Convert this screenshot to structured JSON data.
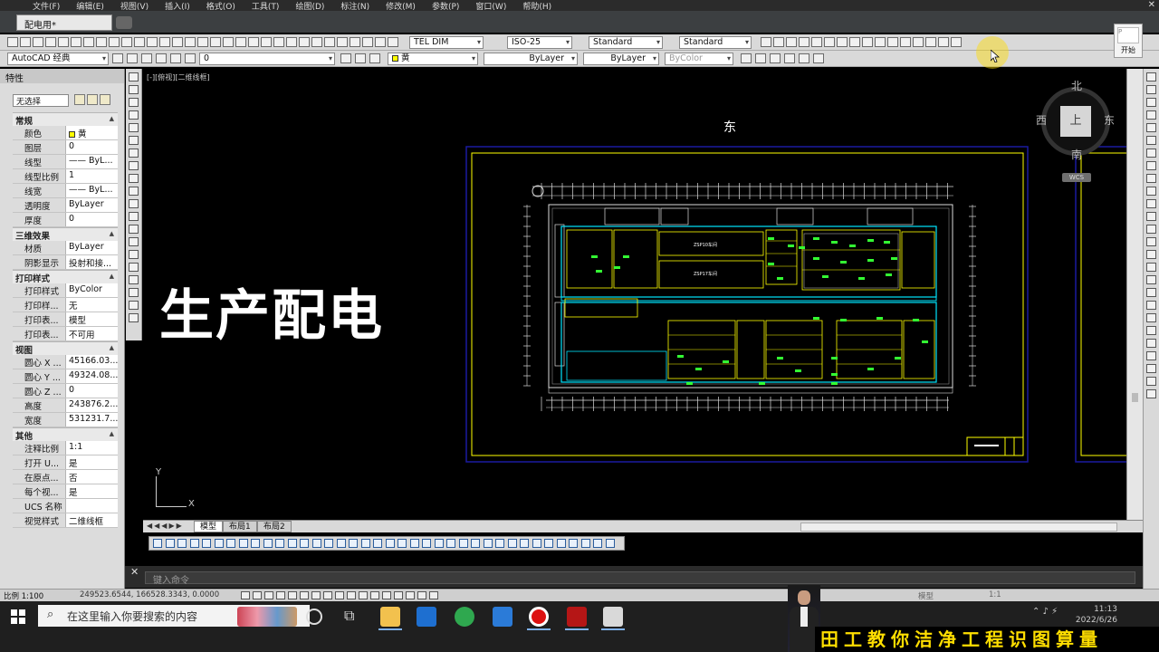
{
  "menu": [
    "文件(F)",
    "编辑(E)",
    "视图(V)",
    "插入(I)",
    "格式(O)",
    "工具(T)",
    "绘图(D)",
    "标注(N)",
    "修改(M)",
    "参数(P)",
    "窗口(W)",
    "帮助(H)"
  ],
  "doc_tab": "配电用*",
  "start_button": "开始",
  "start_preview": "P",
  "toolbar1": {
    "text_style": "TEL DIM",
    "dim_style": "ISO-25",
    "table_style": "Standard",
    "mleader_style": "Standard"
  },
  "toolbar2": {
    "workspace": "AutoCAD 经典",
    "layer": "0",
    "color": "黄",
    "linetype": "ByLayer",
    "lineweight": "ByLayer",
    "plotstyle": "ByColor"
  },
  "properties": {
    "title": "特性",
    "selection": "无选择",
    "sections": [
      {
        "name": "常规",
        "rows": [
          {
            "k": "颜色",
            "v": "黄"
          },
          {
            "k": "图层",
            "v": "0"
          },
          {
            "k": "线型",
            "v": "—— ByL..."
          },
          {
            "k": "线型比例",
            "v": "1"
          },
          {
            "k": "线宽",
            "v": "—— ByL..."
          },
          {
            "k": "透明度",
            "v": "ByLayer"
          },
          {
            "k": "厚度",
            "v": "0"
          }
        ]
      },
      {
        "name": "三维效果",
        "rows": [
          {
            "k": "材质",
            "v": "ByLayer"
          },
          {
            "k": "阴影显示",
            "v": "投射和接..."
          }
        ]
      },
      {
        "name": "打印样式",
        "rows": [
          {
            "k": "打印样式",
            "v": "ByColor"
          },
          {
            "k": "打印样...",
            "v": "无"
          },
          {
            "k": "打印表...",
            "v": "模型"
          },
          {
            "k": "打印表...",
            "v": "不可用"
          }
        ]
      },
      {
        "name": "视图",
        "rows": [
          {
            "k": "圆心 X ...",
            "v": "45166.03..."
          },
          {
            "k": "圆心 Y ...",
            "v": "49324.08..."
          },
          {
            "k": "圆心 Z ...",
            "v": "0"
          },
          {
            "k": "高度",
            "v": "243876.2..."
          },
          {
            "k": "宽度",
            "v": "531231.7..."
          }
        ]
      },
      {
        "name": "其他",
        "rows": [
          {
            "k": "注释比例",
            "v": "1:1"
          },
          {
            "k": "打开 U...",
            "v": "是"
          },
          {
            "k": "在原点...",
            "v": "否"
          },
          {
            "k": "每个视...",
            "v": "是"
          },
          {
            "k": "UCS 名称",
            "v": ""
          },
          {
            "k": "视觉样式",
            "v": "二维线框"
          }
        ]
      }
    ]
  },
  "canvas": {
    "view_label": "[-][俯视][二维线框]",
    "overlay_title": "生产配电",
    "east_label": "东",
    "viewcube": {
      "north": "北",
      "south": "南",
      "east": "东",
      "west": "西",
      "face": "上",
      "wcs": "WCS"
    },
    "room_labels": [
      "ZSP10车间",
      "ZSP17车间"
    ],
    "ucs_x": "X",
    "ucs_y": "Y"
  },
  "layout_tabs": [
    "模型",
    "布局1",
    "布局2"
  ],
  "command_line": {
    "placeholder": "键入命令"
  },
  "status": {
    "scale": "比例 1:100",
    "coords": "249523.6544, 166528.3343, 0.0000",
    "right1": "模型",
    "right2": "1:1"
  },
  "taskbar": {
    "search_placeholder": "在这里输入你要搜索的内容",
    "time": "11:13",
    "date": "2022/6/26"
  },
  "banner": "田工教你洁净工程识图算量",
  "colors": {
    "canvas_bg": "#000000",
    "frame_yellow": "#ffff00",
    "plan_cyan": "#00e5ff",
    "plan_green": "#33ff33",
    "banner_yellow": "#ffde00"
  }
}
